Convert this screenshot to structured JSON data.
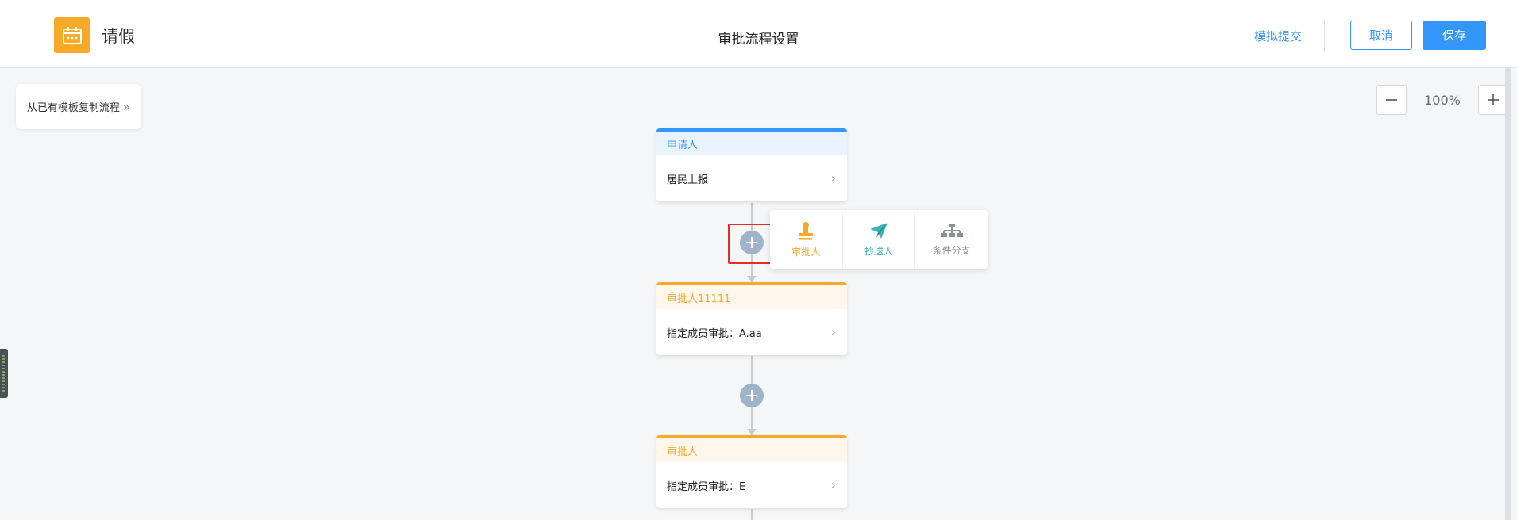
{
  "header": {
    "app_name": "请假",
    "page_title": "审批流程设置",
    "simulate_label": "模拟提交",
    "cancel_label": "取消",
    "save_label": "保存"
  },
  "toolbar": {
    "copy_template_label": "从已有模板复制流程",
    "zoom_level": "100%"
  },
  "flow": {
    "start_node": {
      "title": "申请人",
      "content": "居民上报"
    },
    "add_menu": [
      {
        "label": "审批人",
        "color": "#f7a928",
        "icon": "stamp-icon"
      },
      {
        "label": "抄送人",
        "color": "#3cb4b2",
        "icon": "paper-plane-icon"
      },
      {
        "label": "条件分支",
        "color": "#8a8f96",
        "icon": "org-branch-icon"
      }
    ],
    "approver_nodes": [
      {
        "title": "审批人11111",
        "content": "指定成员审批：A.aa"
      },
      {
        "title": "审批人",
        "content": "指定成员审批：E"
      }
    ]
  },
  "colors": {
    "primary": "#3296fa",
    "approver": "#f7a928",
    "cc": "#3cb4b2",
    "condition": "#8a8f96",
    "highlight": "#e62b2b"
  }
}
